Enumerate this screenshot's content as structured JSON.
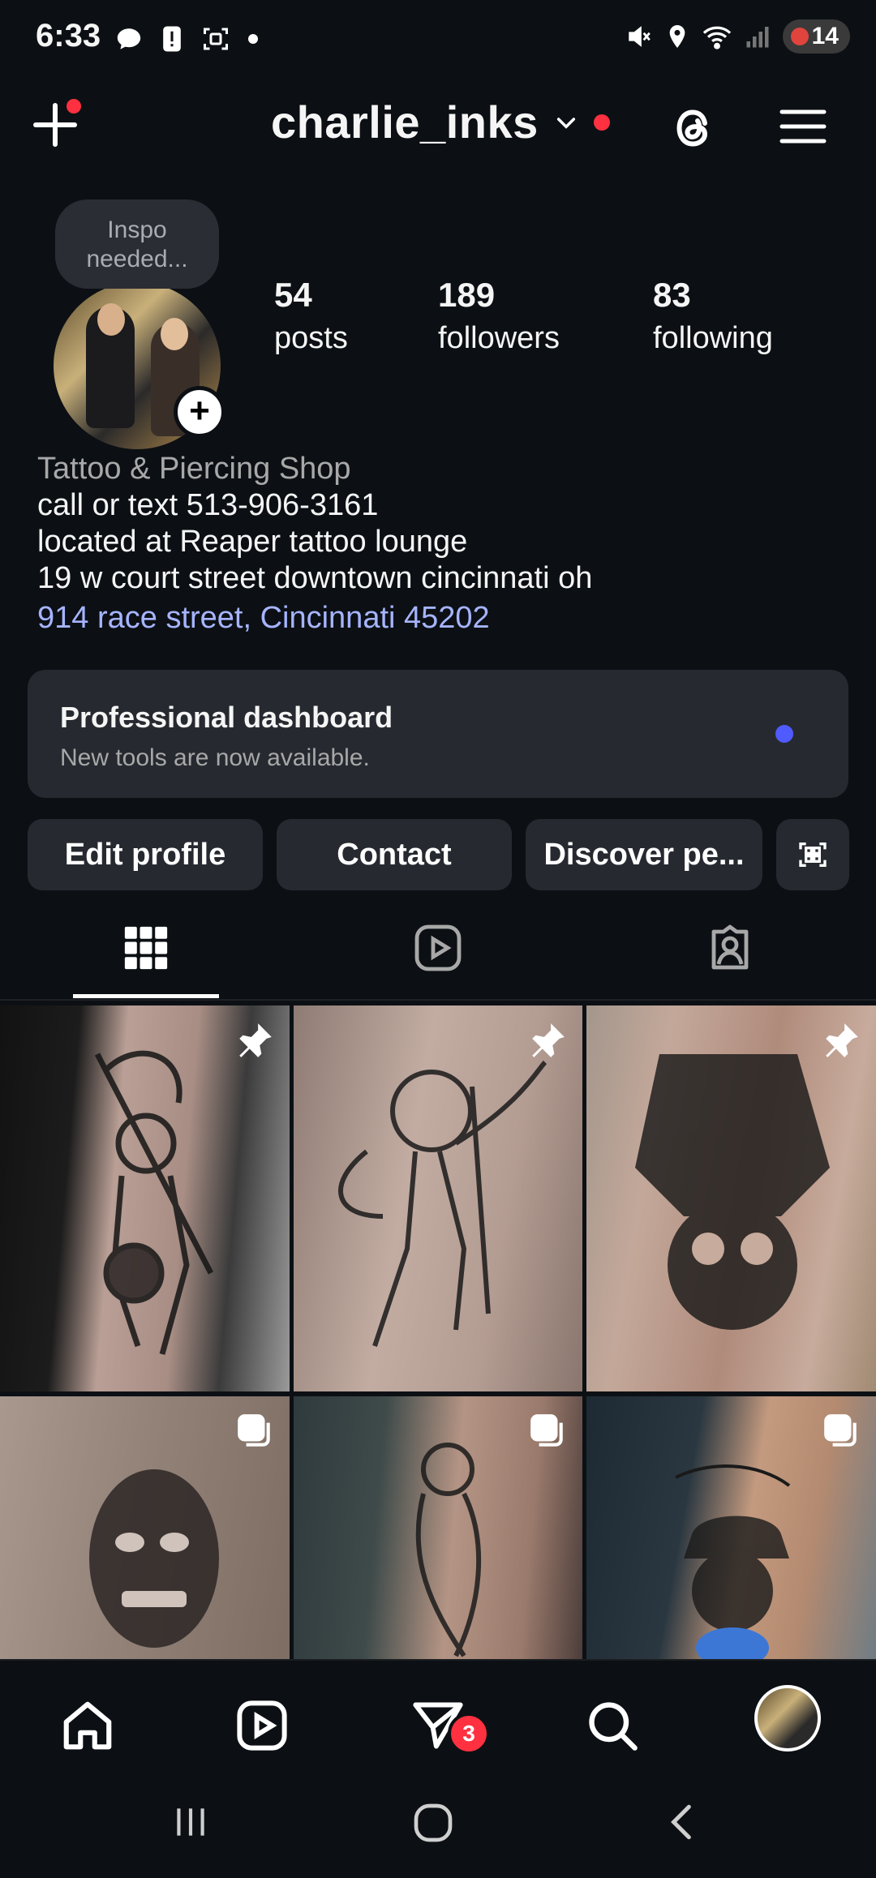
{
  "status_bar": {
    "time": "6:33",
    "battery": "14"
  },
  "header": {
    "username": "charlie_inks"
  },
  "profile": {
    "note": "Inspo needed...",
    "stats": [
      {
        "value": "54",
        "label": "posts"
      },
      {
        "value": "189",
        "label": "followers"
      },
      {
        "value": "83",
        "label": "following"
      }
    ],
    "bio": {
      "category": "Tattoo & Piercing Shop",
      "line1": "call or text 513-906-3161",
      "line2": "located at Reaper tattoo lounge",
      "line3": "19 w court street downtown cincinnati oh",
      "address_link": "914 race street, Cincinnati 45202"
    }
  },
  "dashboard": {
    "title": "Professional dashboard",
    "subtitle": "New tools are now available."
  },
  "buttons": {
    "edit": "Edit profile",
    "contact": "Contact",
    "discover": "Discover pe..."
  },
  "tabs": [
    {
      "icon": "grid-icon",
      "active": true
    },
    {
      "icon": "reels-icon",
      "active": false
    },
    {
      "icon": "tagged-icon",
      "active": false
    }
  ],
  "grid": [
    {
      "kind": "pinned",
      "subject": "grim reaper forearm tattoo"
    },
    {
      "kind": "pinned",
      "subject": "angel tattoo"
    },
    {
      "kind": "pinned",
      "subject": "wolf skull tattoo"
    },
    {
      "kind": "carousel",
      "subject": "clown face tattoo"
    },
    {
      "kind": "carousel",
      "subject": "skeleton embrace tattoo"
    },
    {
      "kind": "carousel",
      "subject": "skull with cap tattoo"
    }
  ],
  "bottom_nav": {
    "messages_badge": "3"
  },
  "colors": {
    "background": "#0c1014",
    "card": "#262a30",
    "accent_link": "#a6b4ff",
    "notification": "#ff3040",
    "dashboard_dot": "#4f5bff"
  }
}
